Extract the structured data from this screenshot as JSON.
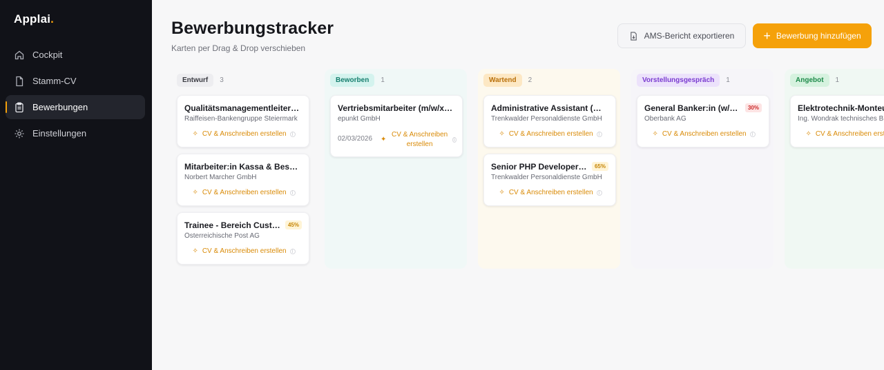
{
  "brand": {
    "name": "Applai",
    "dot": "."
  },
  "sidebar": {
    "items": [
      {
        "label": "Cockpit",
        "icon": "home-icon"
      },
      {
        "label": "Stamm-CV",
        "icon": "document-icon"
      },
      {
        "label": "Bewerbungen",
        "icon": "clipboard-icon",
        "active": true
      },
      {
        "label": "Einstellungen",
        "icon": "gear-icon"
      }
    ]
  },
  "header": {
    "title": "Bewerbungstracker",
    "subtitle": "Karten per Drag & Drop verschieben",
    "export_label": "AMS-Bericht exportieren",
    "add_label": "Bewerbung hinzufügen"
  },
  "colors": {
    "accent": "#f5a10a",
    "sidebar_bg": "#111218"
  },
  "board": {
    "cv_action_label": "CV & Anschreiben erstellen",
    "columns": [
      {
        "status": "Entwurf",
        "count": "3",
        "cards": [
          {
            "title": "Qualitätsmanagementleiter (m/w/d)",
            "company": "Raiffeisen-Bankengruppe Steiermark"
          },
          {
            "title": "Mitarbeiter:in Kassa & Bestellung",
            "company": "Norbert Marcher GmbH"
          },
          {
            "title": "Trainee - Bereich Customer Service",
            "company": "Österreichische Post AG",
            "match": "45%"
          }
        ]
      },
      {
        "status": "Beworben",
        "count": "1",
        "cards": [
          {
            "title": "Vertriebsmitarbeiter (m/w/x) Innendienst",
            "company": "epunkt GmbH",
            "date": "02/03/2026"
          }
        ]
      },
      {
        "status": "Wartend",
        "count": "2",
        "cards": [
          {
            "title": "Administrative Assistant (m/w/d)",
            "company": "Trenkwalder Personaldienste GmbH"
          },
          {
            "title": "Senior PHP Developer (m/w/d)",
            "company": "Trenkwalder Personaldienste GmbH",
            "match": "65%"
          }
        ]
      },
      {
        "status": "Vorstellungsgespräch",
        "count": "1",
        "cards": [
          {
            "title": "General Banker:in (w/m/d)",
            "company": "Oberbank AG",
            "match": "30%"
          }
        ]
      },
      {
        "status": "Angebot",
        "count": "1",
        "cards": [
          {
            "title": "Elektrotechnik-Monteur",
            "company": "Ing. Wondrak technisches Büro"
          }
        ]
      }
    ]
  }
}
